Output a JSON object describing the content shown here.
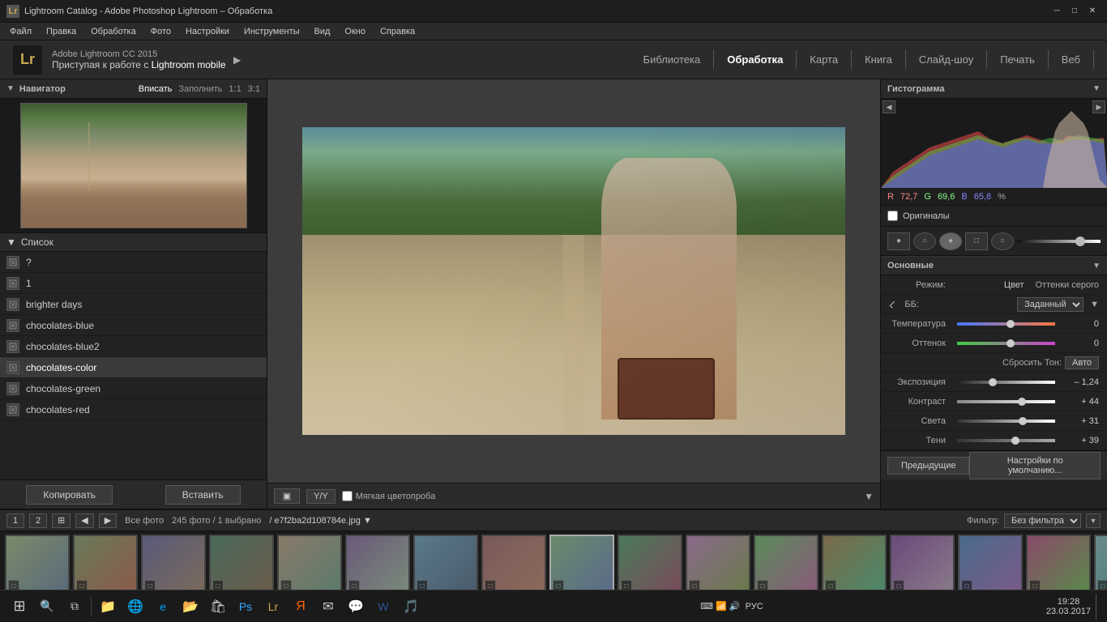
{
  "window": {
    "title": "Lightroom Catalog - Adobe Photoshop Lightroom – Обработка",
    "icon": "Lr"
  },
  "menubar": {
    "items": [
      "Файл",
      "Правка",
      "Обработка",
      "Фото",
      "Настройки",
      "Инструменты",
      "Вид",
      "Окно",
      "Справка"
    ]
  },
  "header": {
    "brand_name": "Adobe Lightroom CC 2015",
    "brand_sub_prefix": "Приступая к работе с ",
    "brand_sub_highlight": "Lightroom mobile",
    "modules": [
      "Библиотека",
      "Обработка",
      "Карта",
      "Книга",
      "Слайд-шоу",
      "Печать",
      "Веб"
    ],
    "active_module": "Обработка"
  },
  "navigator": {
    "title": "Навигатор",
    "options": [
      "Вписать",
      "Заполнить",
      "1:1",
      "3:1"
    ]
  },
  "presets": {
    "title": "Список",
    "items": [
      {
        "name": "?",
        "selected": false
      },
      {
        "name": "1",
        "selected": false
      },
      {
        "name": "brighter days",
        "selected": false
      },
      {
        "name": "chocolates-blue",
        "selected": false
      },
      {
        "name": "chocolates-blue2",
        "selected": false
      },
      {
        "name": "chocolates-color",
        "selected": true
      },
      {
        "name": "chocolates-green",
        "selected": false
      },
      {
        "name": "chocolates-red",
        "selected": false
      }
    ]
  },
  "left_buttons": {
    "copy": "Копировать",
    "paste": "Вставить"
  },
  "bottom_toolbar": {
    "view_btn": "▣",
    "y_btn": "Y/Y",
    "soft_proof_label": "Мягкая цветопроба",
    "end_btn": "▼"
  },
  "histogram": {
    "title": "Гистограмма",
    "r_label": "R",
    "r_value": "72,7",
    "g_label": "G",
    "g_value": "69,6",
    "b_label": "B",
    "b_value": "65,8",
    "pct": "%"
  },
  "originals": {
    "label": "Оригиналы"
  },
  "basic": {
    "title": "Основные",
    "mode_label": "Режим:",
    "mode_color": "Цвет",
    "mode_grayscale": "Оттенки серого",
    "wb_label": "ББ:",
    "wb_value": "Заданный",
    "temp_label": "Температура",
    "temp_value": "0",
    "tint_label": "Оттенок",
    "tint_value": "0",
    "reset_label": "Сбросить Тон:",
    "reset_btn": "Авто",
    "exposure_label": "Экспозиция",
    "exposure_value": "– 1,24",
    "contrast_label": "Контраст",
    "contrast_value": "+ 44",
    "highlights_label": "Света",
    "highlights_value": "+ 31",
    "shadows_label": "Тени",
    "shadows_value": "+ 39"
  },
  "right_buttons": {
    "prev": "Предыдущие",
    "defaults": "Настройки по умолчанию..."
  },
  "filmstrip": {
    "btn1": "1",
    "btn2": "2",
    "grid_btn": "⊞",
    "prev_btn": "◀",
    "next_btn": "▶",
    "all_photos": "Все фото",
    "count": "245 фото / 1 выбрано",
    "filename": "e7f2ba2d108784e.jpg",
    "filter_label": "Фильтр:",
    "filter_value": "Без фильтра"
  },
  "taskbar": {
    "time": "19:28",
    "date": "23.03.2017",
    "lang": "РУС"
  },
  "thumb_colors": [
    "#7a8a6a",
    "#6a7a8a",
    "#8a7a6a",
    "#5a6a7a",
    "#7a6a5a",
    "#6a8a7a",
    "#8a6a7a",
    "#7a5a6a",
    "#5a7a6a",
    "#8a7a5a",
    "#6a5a8a",
    "#7a8a5a",
    "#5a8a7a",
    "#8a5a6a",
    "#6a7a5a",
    "#5a6a8a",
    "#7a6a8a"
  ]
}
